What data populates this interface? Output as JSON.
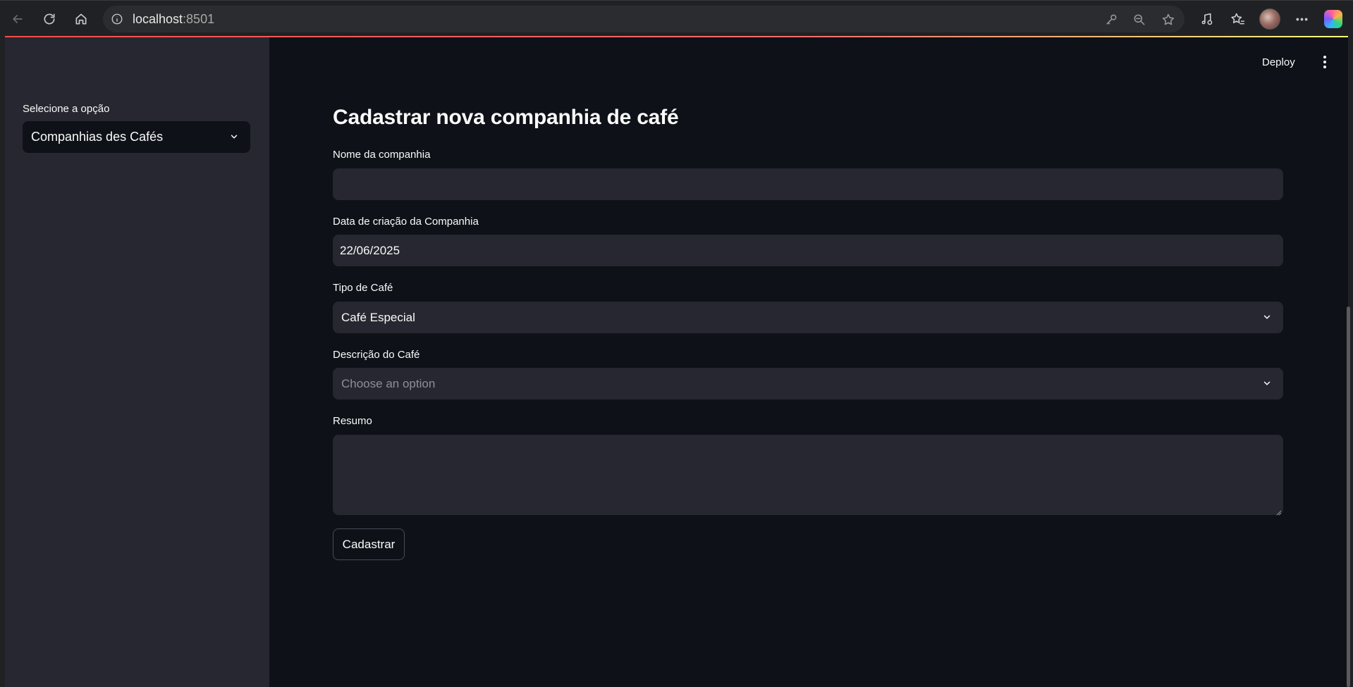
{
  "browser": {
    "url_host": "localhost",
    "url_port": ":8501",
    "icons": [
      "back-icon",
      "reload-icon",
      "home-icon",
      "site-info-icon",
      "key-icon",
      "zoom-out-icon",
      "star-icon",
      "media-icon",
      "favorites-icon",
      "profile-avatar",
      "more-icon",
      "copilot-icon"
    ]
  },
  "colors": {
    "app_background": "#0e1117",
    "sidebar_background": "#262730",
    "input_background": "#262730",
    "accent_gradient_start": "#ff4b4b",
    "accent_gradient_end": "#fffd80"
  },
  "app_header": {
    "deploy_label": "Deploy"
  },
  "sidebar": {
    "select_label": "Selecione a opção",
    "select_value": "Companhias des Cafés"
  },
  "main": {
    "title": "Cadastrar nova companhia de café",
    "fields": {
      "company_name": {
        "label": "Nome da companhia",
        "value": ""
      },
      "creation_date": {
        "label": "Data de criação da Companhia",
        "value": "22/06/2025"
      },
      "coffee_type": {
        "label": "Tipo de Café",
        "value": "Café Especial"
      },
      "coffee_description": {
        "label": "Descrição do Café",
        "placeholder": "Choose an option"
      },
      "summary": {
        "label": "Resumo",
        "value": ""
      }
    },
    "submit_label": "Cadastrar"
  }
}
